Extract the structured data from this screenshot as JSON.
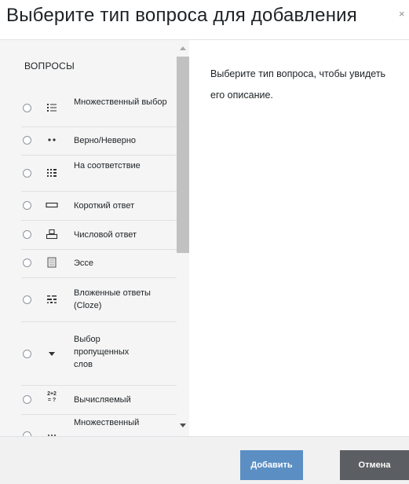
{
  "dialog": {
    "title": "Выберите тип вопроса для добавления",
    "close_glyph": "×"
  },
  "options": {
    "section_label": "ВОПРОСЫ",
    "items": [
      {
        "label": "Множественный выбор",
        "icon": "multichoice-icon"
      },
      {
        "label": "Верно/Неверно",
        "icon": "truefalse-icon"
      },
      {
        "label": "На соответствие",
        "icon": "match-icon"
      },
      {
        "label": "Короткий ответ",
        "icon": "shortanswer-icon"
      },
      {
        "label": "Числовой ответ",
        "icon": "numerical-icon"
      },
      {
        "label": "Эссе",
        "icon": "essay-icon"
      },
      {
        "label": "Вложенные ответы (Cloze)",
        "icon": "cloze-icon"
      },
      {
        "label": "Выбор пропущенных слов",
        "icon": "gapselect-icon"
      },
      {
        "label": "Вычисляемый",
        "icon": "calculated-icon",
        "icon_text": "2+2\n= ?"
      },
      {
        "label": "Множественный",
        "icon": "calculatedmulti-icon"
      }
    ]
  },
  "description": "Выберите тип вопроса, чтобы увидеть его описание.",
  "footer": {
    "add_label": "Добавить",
    "cancel_label": "Отмена"
  }
}
